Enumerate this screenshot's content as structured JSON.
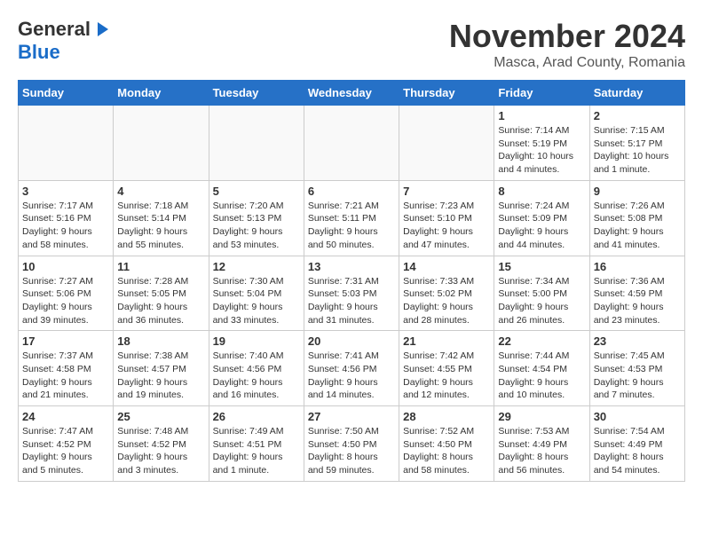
{
  "header": {
    "logo_general": "General",
    "logo_blue": "Blue",
    "month_title": "November 2024",
    "location": "Masca, Arad County, Romania"
  },
  "days_of_week": [
    "Sunday",
    "Monday",
    "Tuesday",
    "Wednesday",
    "Thursday",
    "Friday",
    "Saturday"
  ],
  "weeks": [
    [
      {
        "day": "",
        "info": ""
      },
      {
        "day": "",
        "info": ""
      },
      {
        "day": "",
        "info": ""
      },
      {
        "day": "",
        "info": ""
      },
      {
        "day": "",
        "info": ""
      },
      {
        "day": "1",
        "info": "Sunrise: 7:14 AM\nSunset: 5:19 PM\nDaylight: 10 hours\nand 4 minutes."
      },
      {
        "day": "2",
        "info": "Sunrise: 7:15 AM\nSunset: 5:17 PM\nDaylight: 10 hours\nand 1 minute."
      }
    ],
    [
      {
        "day": "3",
        "info": "Sunrise: 7:17 AM\nSunset: 5:16 PM\nDaylight: 9 hours\nand 58 minutes."
      },
      {
        "day": "4",
        "info": "Sunrise: 7:18 AM\nSunset: 5:14 PM\nDaylight: 9 hours\nand 55 minutes."
      },
      {
        "day": "5",
        "info": "Sunrise: 7:20 AM\nSunset: 5:13 PM\nDaylight: 9 hours\nand 53 minutes."
      },
      {
        "day": "6",
        "info": "Sunrise: 7:21 AM\nSunset: 5:11 PM\nDaylight: 9 hours\nand 50 minutes."
      },
      {
        "day": "7",
        "info": "Sunrise: 7:23 AM\nSunset: 5:10 PM\nDaylight: 9 hours\nand 47 minutes."
      },
      {
        "day": "8",
        "info": "Sunrise: 7:24 AM\nSunset: 5:09 PM\nDaylight: 9 hours\nand 44 minutes."
      },
      {
        "day": "9",
        "info": "Sunrise: 7:26 AM\nSunset: 5:08 PM\nDaylight: 9 hours\nand 41 minutes."
      }
    ],
    [
      {
        "day": "10",
        "info": "Sunrise: 7:27 AM\nSunset: 5:06 PM\nDaylight: 9 hours\nand 39 minutes."
      },
      {
        "day": "11",
        "info": "Sunrise: 7:28 AM\nSunset: 5:05 PM\nDaylight: 9 hours\nand 36 minutes."
      },
      {
        "day": "12",
        "info": "Sunrise: 7:30 AM\nSunset: 5:04 PM\nDaylight: 9 hours\nand 33 minutes."
      },
      {
        "day": "13",
        "info": "Sunrise: 7:31 AM\nSunset: 5:03 PM\nDaylight: 9 hours\nand 31 minutes."
      },
      {
        "day": "14",
        "info": "Sunrise: 7:33 AM\nSunset: 5:02 PM\nDaylight: 9 hours\nand 28 minutes."
      },
      {
        "day": "15",
        "info": "Sunrise: 7:34 AM\nSunset: 5:00 PM\nDaylight: 9 hours\nand 26 minutes."
      },
      {
        "day": "16",
        "info": "Sunrise: 7:36 AM\nSunset: 4:59 PM\nDaylight: 9 hours\nand 23 minutes."
      }
    ],
    [
      {
        "day": "17",
        "info": "Sunrise: 7:37 AM\nSunset: 4:58 PM\nDaylight: 9 hours\nand 21 minutes."
      },
      {
        "day": "18",
        "info": "Sunrise: 7:38 AM\nSunset: 4:57 PM\nDaylight: 9 hours\nand 19 minutes."
      },
      {
        "day": "19",
        "info": "Sunrise: 7:40 AM\nSunset: 4:56 PM\nDaylight: 9 hours\nand 16 minutes."
      },
      {
        "day": "20",
        "info": "Sunrise: 7:41 AM\nSunset: 4:56 PM\nDaylight: 9 hours\nand 14 minutes."
      },
      {
        "day": "21",
        "info": "Sunrise: 7:42 AM\nSunset: 4:55 PM\nDaylight: 9 hours\nand 12 minutes."
      },
      {
        "day": "22",
        "info": "Sunrise: 7:44 AM\nSunset: 4:54 PM\nDaylight: 9 hours\nand 10 minutes."
      },
      {
        "day": "23",
        "info": "Sunrise: 7:45 AM\nSunset: 4:53 PM\nDaylight: 9 hours\nand 7 minutes."
      }
    ],
    [
      {
        "day": "24",
        "info": "Sunrise: 7:47 AM\nSunset: 4:52 PM\nDaylight: 9 hours\nand 5 minutes."
      },
      {
        "day": "25",
        "info": "Sunrise: 7:48 AM\nSunset: 4:52 PM\nDaylight: 9 hours\nand 3 minutes."
      },
      {
        "day": "26",
        "info": "Sunrise: 7:49 AM\nSunset: 4:51 PM\nDaylight: 9 hours\nand 1 minute."
      },
      {
        "day": "27",
        "info": "Sunrise: 7:50 AM\nSunset: 4:50 PM\nDaylight: 8 hours\nand 59 minutes."
      },
      {
        "day": "28",
        "info": "Sunrise: 7:52 AM\nSunset: 4:50 PM\nDaylight: 8 hours\nand 58 minutes."
      },
      {
        "day": "29",
        "info": "Sunrise: 7:53 AM\nSunset: 4:49 PM\nDaylight: 8 hours\nand 56 minutes."
      },
      {
        "day": "30",
        "info": "Sunrise: 7:54 AM\nSunset: 4:49 PM\nDaylight: 8 hours\nand 54 minutes."
      }
    ]
  ]
}
